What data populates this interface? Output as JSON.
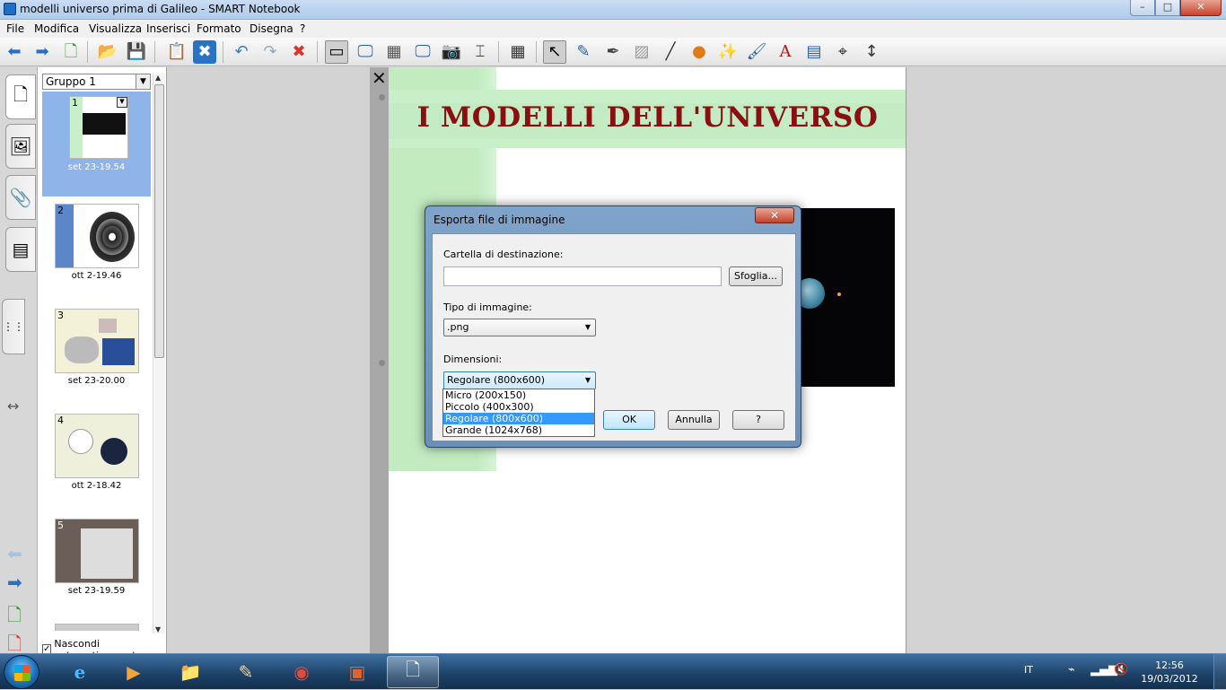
{
  "window": {
    "title": "modelli universo prima di Galileo - SMART Notebook",
    "min_label": "–",
    "max_label": "□",
    "close_label": "✕"
  },
  "menu": [
    "File",
    "Modifica",
    "Visualizza",
    "Inserisci",
    "Formato",
    "Disegna",
    "?"
  ],
  "sorter": {
    "group": "Gruppo 1",
    "slides": [
      {
        "num": "1",
        "caption": "set 23-19.54"
      },
      {
        "num": "2",
        "caption": "ott 2-19.46"
      },
      {
        "num": "3",
        "caption": "set 23-20.00"
      },
      {
        "num": "4",
        "caption": "ott 2-18.42"
      },
      {
        "num": "5",
        "caption": "set 23-19.59"
      }
    ],
    "autohide_label": "Nascondi automaticamente",
    "autohide_checked": "✓"
  },
  "page": {
    "title": "I MODELLI DELL'UNIVERSO",
    "close_glyph": "✕"
  },
  "dialog": {
    "title": "Esporta file di immagine",
    "close": "✕",
    "dest_label": "Cartella di destinazione:",
    "dest_value": "",
    "browse": "Sfoglia...",
    "type_label": "Tipo di immagine:",
    "type_value": ".png",
    "dim_label": "Dimensioni:",
    "dim_value": "Regolare (800x600)",
    "dim_options": [
      "Micro (200x150)",
      "Piccolo (400x300)",
      "Regolare (800x600)",
      "Grande (1024x768)"
    ],
    "ok": "OK",
    "cancel": "Annulla",
    "help": "?"
  },
  "taskbar": {
    "lang": "IT",
    "time": "12:56",
    "date": "19/03/2012"
  }
}
